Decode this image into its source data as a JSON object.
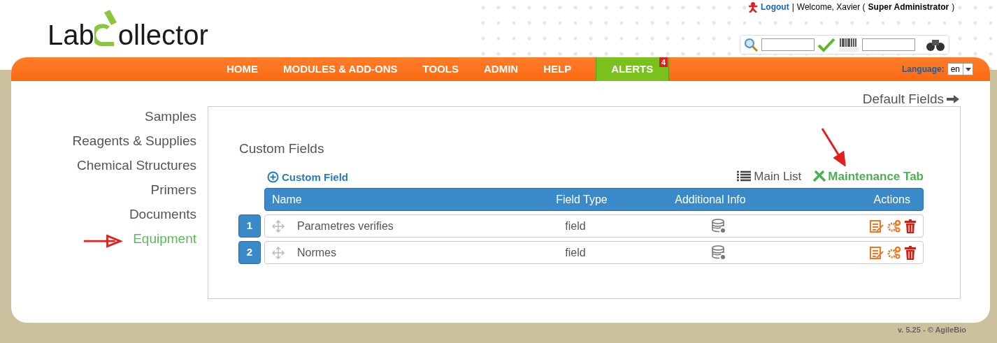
{
  "header": {
    "logo_left": "Lab",
    "logo_right": "ollector",
    "user": {
      "logout": "Logout",
      "separator": "|",
      "welcome": "Welcome, Xavier (",
      "role": "Super Administrator",
      "close": ")"
    }
  },
  "nav": {
    "items": [
      {
        "label": "HOME",
        "selected": false
      },
      {
        "label": "MODULES & ADD-ONS",
        "selected": false
      },
      {
        "label": "TOOLS",
        "selected": false
      },
      {
        "label": "ADMIN",
        "selected": false
      },
      {
        "label": "HELP",
        "selected": false
      },
      {
        "label": "ALERTS",
        "selected": true,
        "badge": "4"
      }
    ],
    "language_label": "Language:",
    "language_value": "en"
  },
  "default_fields_link": "Default Fields",
  "sidebar": {
    "items": [
      {
        "label": "Samples",
        "selected": false
      },
      {
        "label": "Reagents & Supplies",
        "selected": false
      },
      {
        "label": "Chemical Structures",
        "selected": false
      },
      {
        "label": "Primers",
        "selected": false
      },
      {
        "label": "Documents",
        "selected": false
      },
      {
        "label": "Equipment",
        "selected": true
      }
    ]
  },
  "panel": {
    "title": "Custom Fields",
    "add_link": "Custom Field",
    "main_list_link": "Main List",
    "maintenance_link": "Maintenance Tab",
    "table": {
      "columns": [
        "Name",
        "Field Type",
        "Additional Info",
        "Actions"
      ],
      "rows": [
        {
          "number": "1",
          "name": "Parametres verifies",
          "type": "field"
        },
        {
          "number": "2",
          "name": "Normes",
          "type": "field"
        }
      ]
    }
  },
  "footer": "v. 5.25 - © AgileBio"
}
